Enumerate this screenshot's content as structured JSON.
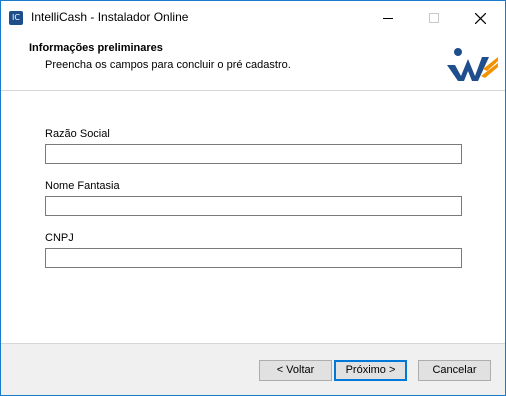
{
  "window": {
    "title": "IntelliCash - Instalador Online",
    "app_icon_text": "IC"
  },
  "header": {
    "title": "Informações preliminares",
    "subtitle": "Preencha os campos para concluir o pré cadastro."
  },
  "form": {
    "fields": [
      {
        "label": "Razão Social",
        "value": ""
      },
      {
        "label": "Nome Fantasia",
        "value": ""
      },
      {
        "label": "CNPJ",
        "value": ""
      }
    ]
  },
  "buttons": {
    "back": "< Voltar",
    "next": "Próximo >",
    "cancel": "Cancelar"
  },
  "colors": {
    "window_border": "#1979ca",
    "logo_blue": "#1f4e8c",
    "logo_orange": "#f39200",
    "focus_border": "#0078d7"
  },
  "icons": {
    "app": "app-icon",
    "minimize": "minimize-icon",
    "maximize": "maximize-icon",
    "close": "close-icon",
    "logo": "company-logo"
  }
}
